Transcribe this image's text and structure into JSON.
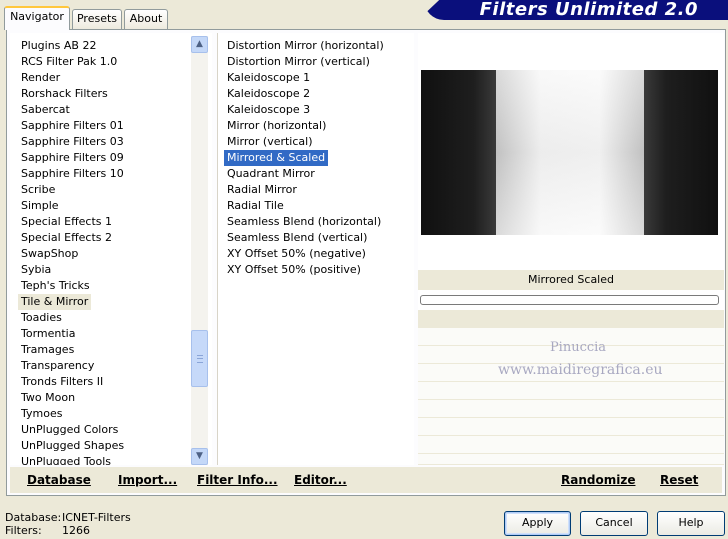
{
  "tabs": [
    {
      "label": "Navigator",
      "active": true
    },
    {
      "label": "Presets",
      "active": false
    },
    {
      "label": "About",
      "active": false
    }
  ],
  "app_title": "Filters Unlimited 2.0",
  "categories": [
    {
      "label": "Plugins AB 22"
    },
    {
      "label": "RCS Filter Pak 1.0"
    },
    {
      "label": "Render"
    },
    {
      "label": "Rorshack Filters"
    },
    {
      "label": "Sabercat"
    },
    {
      "label": "Sapphire Filters 01"
    },
    {
      "label": "Sapphire Filters 03"
    },
    {
      "label": "Sapphire Filters 09"
    },
    {
      "label": "Sapphire Filters 10"
    },
    {
      "label": "Scribe"
    },
    {
      "label": "Simple"
    },
    {
      "label": "Special Effects 1"
    },
    {
      "label": "Special Effects 2"
    },
    {
      "label": "SwapShop"
    },
    {
      "label": "Sybia"
    },
    {
      "label": "Teph's Tricks"
    },
    {
      "label": "Tile & Mirror",
      "selected": true
    },
    {
      "label": "Toadies"
    },
    {
      "label": "Tormentia"
    },
    {
      "label": "Tramages"
    },
    {
      "label": "Transparency"
    },
    {
      "label": "Tronds Filters II"
    },
    {
      "label": "Two Moon"
    },
    {
      "label": "Tymoes"
    },
    {
      "label": "UnPlugged Colors"
    },
    {
      "label": "UnPlugged Shapes"
    },
    {
      "label": "UnPlugged Tools"
    }
  ],
  "category_scroll": 0.82,
  "filters": [
    {
      "label": "Distortion Mirror (horizontal)"
    },
    {
      "label": "Distortion Mirror (vertical)"
    },
    {
      "label": "Kaleidoscope 1"
    },
    {
      "label": "Kaleidoscope 2"
    },
    {
      "label": "Kaleidoscope 3"
    },
    {
      "label": "Mirror (horizontal)"
    },
    {
      "label": "Mirror (vertical)"
    },
    {
      "label": "Mirrored & Scaled",
      "selected": true
    },
    {
      "label": "Quadrant Mirror"
    },
    {
      "label": "Radial Mirror"
    },
    {
      "label": "Radial Tile"
    },
    {
      "label": "Seamless Blend (horizontal)"
    },
    {
      "label": "Seamless Blend (vertical)"
    },
    {
      "label": "XY Offset 50% (negative)"
    },
    {
      "label": "XY Offset 50% (positive)"
    }
  ],
  "preview": {
    "caption": "Mirrored  Scaled",
    "watermark_line1": "Pinuccia",
    "watermark_line2": "www.maidiregrafica.eu"
  },
  "panel_links": {
    "database": "Database",
    "import": "Import...",
    "filter_info": "Filter Info...",
    "editor": "Editor...",
    "randomize": "Randomize",
    "reset": "Reset"
  },
  "status": {
    "database_label": "Database:",
    "database_value": "ICNET-Filters",
    "filters_label": "Filters:",
    "filters_value": "1266"
  },
  "buttons": {
    "apply": "Apply",
    "cancel": "Cancel",
    "help": "Help"
  },
  "colors": {
    "selection": "#316ac5",
    "banner": "#0a0f7c",
    "face": "#ece9d8"
  },
  "icons": {
    "scroll_up": "chevron-up-icon",
    "scroll_down": "chevron-down-icon"
  }
}
